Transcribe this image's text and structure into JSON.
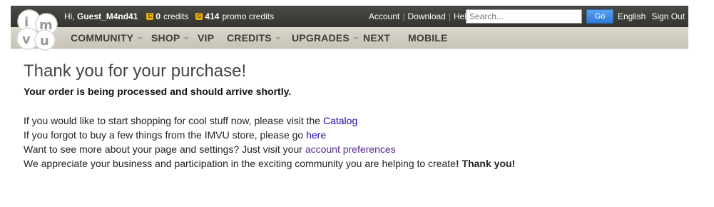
{
  "header": {
    "greeting_prefix": "Hi,",
    "username": "Guest_M4nd41",
    "credits": {
      "amount": "0",
      "label": "credits"
    },
    "promo_credits": {
      "amount": "414",
      "label": "promo credits"
    },
    "links": {
      "account": "Account",
      "download": "Download",
      "help": "Help"
    },
    "search": {
      "placeholder": "Search...",
      "value": ""
    },
    "go_label": "Go",
    "language": "English",
    "sign_out": "Sign Out",
    "coin_glyph": "C"
  },
  "nav": {
    "items": [
      {
        "label": "COMMUNITY",
        "has_dropdown": true
      },
      {
        "label": "SHOP",
        "has_dropdown": true
      },
      {
        "label": "VIP",
        "has_dropdown": false
      },
      {
        "label": "CREDITS",
        "has_dropdown": true
      },
      {
        "label": "UPGRADES",
        "has_dropdown": true
      },
      {
        "label": "NEXT",
        "has_dropdown": false
      },
      {
        "label": "MOBILE",
        "has_dropdown": false
      }
    ]
  },
  "main": {
    "title": "Thank you for your purchase!",
    "subtitle": "Your order is being processed and should arrive shortly.",
    "line1": {
      "text": "If you would like to start shopping for cool stuff now, please visit the ",
      "link": "Catalog"
    },
    "line2": {
      "text": "If you forgot to buy a few things from the IMVU store, please go ",
      "link": "here"
    },
    "line3": {
      "text": "Want to see more about your page and settings? Just visit your ",
      "link": "account preferences"
    },
    "line4": {
      "text": "We appreciate your business and participation in the exciting community you are helping to create",
      "bold_end": "! Thank you!"
    }
  },
  "colors": {
    "topbar": "#3e3e38",
    "navbar": "#d0ccc0",
    "link": "#1a0dab",
    "visited_link": "#5a2a8a",
    "go_button": "#3f8ae0",
    "coin": "#e8b100"
  }
}
